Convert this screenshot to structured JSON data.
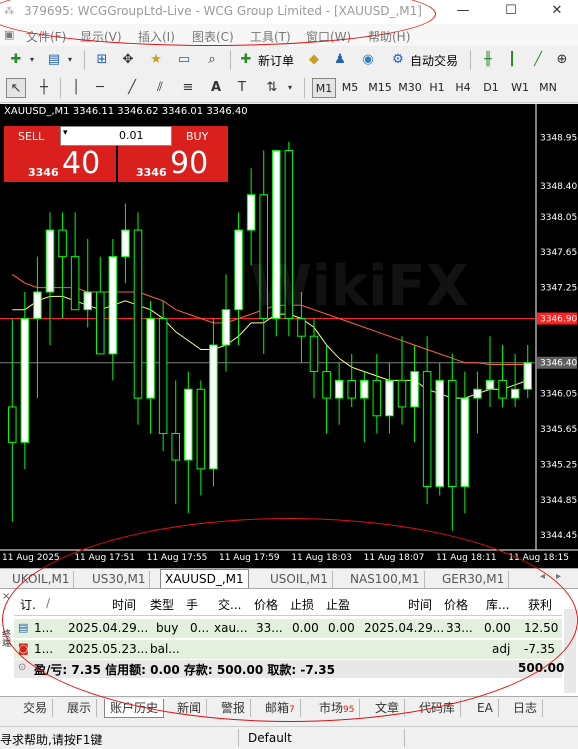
{
  "window": {
    "title": "379695: WCGGroupLtd-Live - WCG Group Limited - [XAUUSD_,M1]",
    "app_icon": "mt4-icon"
  },
  "menu": [
    "文件(F)",
    "显示(V)",
    "插入(I)",
    "图表(C)",
    "工具(T)",
    "窗口(W)",
    "帮助(H)"
  ],
  "toolbar1": {
    "new_order_label": "新订单",
    "auto_trade_label": "自动交易"
  },
  "timeframes": [
    "M1",
    "M5",
    "M15",
    "M30",
    "H1",
    "H4",
    "D1",
    "W1",
    "MN"
  ],
  "active_timeframe": "M1",
  "chart": {
    "title": "XAUUSD_,M1  3346.11 3346.62 3346.01 3346.40",
    "watermark": "WikiFX",
    "price_labels": [
      "3348.95",
      "3348.40",
      "3348.05",
      "3347.65",
      "3347.25",
      "3346.90",
      "3346.40",
      "3346.05",
      "3345.65",
      "3345.25",
      "3344.85",
      "3344.45"
    ],
    "bid_tag": "3346.40",
    "ask_tag": "3346.90",
    "time_labels": [
      "11 Aug 2025",
      "11 Aug 17:51",
      "11 Aug 17:55",
      "11 Aug 17:59",
      "11 Aug 18:03",
      "11 Aug 18:07",
      "11 Aug 18:11",
      "11 Aug 18:15"
    ],
    "colors": {
      "bull": "#ffffff",
      "bear": "#000000",
      "wick": "#00ff00",
      "ma_fast": "#ffff80",
      "ma_slow": "#ff6040",
      "ask_line": "#ff2020",
      "bid_line": "#808080"
    }
  },
  "chart_data": {
    "type": "candlestick",
    "title": "XAUUSD_,M1",
    "ylim": [
      3344.35,
      3349.1
    ],
    "candles": [
      {
        "o": 3345.9,
        "h": 3346.9,
        "l": 3344.6,
        "c": 3345.5
      },
      {
        "o": 3345.5,
        "h": 3347.2,
        "l": 3345.2,
        "c": 3346.9
      },
      {
        "o": 3346.9,
        "h": 3347.6,
        "l": 3346.0,
        "c": 3347.2
      },
      {
        "o": 3347.2,
        "h": 3348.1,
        "l": 3346.6,
        "c": 3347.9
      },
      {
        "o": 3347.9,
        "h": 3348.1,
        "l": 3346.9,
        "c": 3347.6
      },
      {
        "o": 3347.6,
        "h": 3348.1,
        "l": 3347.0,
        "c": 3347.0
      },
      {
        "o": 3347.0,
        "h": 3347.8,
        "l": 3346.8,
        "c": 3347.2
      },
      {
        "o": 3347.2,
        "h": 3347.6,
        "l": 3346.6,
        "c": 3346.5
      },
      {
        "o": 3346.5,
        "h": 3347.8,
        "l": 3346.2,
        "c": 3347.6
      },
      {
        "o": 3347.6,
        "h": 3348.2,
        "l": 3347.3,
        "c": 3347.9
      },
      {
        "o": 3347.9,
        "h": 3348.1,
        "l": 3345.7,
        "c": 3346.0
      },
      {
        "o": 3346.0,
        "h": 3347.1,
        "l": 3345.6,
        "c": 3346.9
      },
      {
        "o": 3346.9,
        "h": 3347.1,
        "l": 3345.4,
        "c": 3345.6
      },
      {
        "o": 3345.6,
        "h": 3346.2,
        "l": 3344.8,
        "c": 3345.3
      },
      {
        "o": 3345.3,
        "h": 3346.3,
        "l": 3344.7,
        "c": 3346.1
      },
      {
        "o": 3346.1,
        "h": 3346.2,
        "l": 3344.9,
        "c": 3345.2
      },
      {
        "o": 3345.2,
        "h": 3346.9,
        "l": 3345.0,
        "c": 3346.6
      },
      {
        "o": 3346.6,
        "h": 3347.4,
        "l": 3346.3,
        "c": 3347.0
      },
      {
        "o": 3347.0,
        "h": 3348.1,
        "l": 3346.6,
        "c": 3347.9
      },
      {
        "o": 3347.9,
        "h": 3348.6,
        "l": 3347.5,
        "c": 3348.3
      },
      {
        "o": 3348.3,
        "h": 3348.8,
        "l": 3346.5,
        "c": 3346.9
      },
      {
        "o": 3346.9,
        "h": 3348.8,
        "l": 3346.7,
        "c": 3348.8
      },
      {
        "o": 3348.8,
        "h": 3348.9,
        "l": 3346.7,
        "c": 3346.9
      },
      {
        "o": 3346.9,
        "h": 3347.2,
        "l": 3346.4,
        "c": 3346.7
      },
      {
        "o": 3346.7,
        "h": 3346.9,
        "l": 3346.0,
        "c": 3346.3
      },
      {
        "o": 3346.3,
        "h": 3346.6,
        "l": 3345.6,
        "c": 3346.0
      },
      {
        "o": 3346.0,
        "h": 3346.4,
        "l": 3345.7,
        "c": 3346.2
      },
      {
        "o": 3346.2,
        "h": 3346.5,
        "l": 3345.9,
        "c": 3346.0
      },
      {
        "o": 3346.0,
        "h": 3346.3,
        "l": 3345.5,
        "c": 3346.2
      },
      {
        "o": 3346.2,
        "h": 3346.5,
        "l": 3345.6,
        "c": 3345.8
      },
      {
        "o": 3345.8,
        "h": 3346.4,
        "l": 3345.6,
        "c": 3346.2
      },
      {
        "o": 3346.2,
        "h": 3346.7,
        "l": 3345.7,
        "c": 3345.9
      },
      {
        "o": 3345.9,
        "h": 3346.6,
        "l": 3345.5,
        "c": 3346.3
      },
      {
        "o": 3346.3,
        "h": 3346.7,
        "l": 3344.8,
        "c": 3345.0
      },
      {
        "o": 3345.0,
        "h": 3346.4,
        "l": 3344.9,
        "c": 3346.2
      },
      {
        "o": 3346.2,
        "h": 3346.5,
        "l": 3344.5,
        "c": 3345.0
      },
      {
        "o": 3345.0,
        "h": 3346.3,
        "l": 3344.7,
        "c": 3346.0
      },
      {
        "o": 3346.0,
        "h": 3346.3,
        "l": 3345.6,
        "c": 3346.1
      },
      {
        "o": 3346.1,
        "h": 3346.7,
        "l": 3345.9,
        "c": 3346.2
      },
      {
        "o": 3346.2,
        "h": 3346.6,
        "l": 3345.9,
        "c": 3346.0
      },
      {
        "o": 3346.0,
        "h": 3346.5,
        "l": 3345.9,
        "c": 3346.1
      },
      {
        "o": 3346.1,
        "h": 3346.6,
        "l": 3346.0,
        "c": 3346.4
      }
    ],
    "ma_fast": [
      3347.0,
      3347.0,
      3347.1,
      3347.15,
      3347.15,
      3347.1,
      3347.05,
      3347.0,
      3347.05,
      3347.1,
      3347.05,
      3347.0,
      3346.9,
      3346.75,
      3346.65,
      3346.55,
      3346.55,
      3346.6,
      3346.7,
      3346.85,
      3346.85,
      3346.95,
      3346.95,
      3346.9,
      3346.8,
      3346.6,
      3346.45,
      3346.35,
      3346.3,
      3346.25,
      3346.2,
      3346.2,
      3346.2,
      3346.1,
      3346.05,
      3346.0,
      3346.0,
      3346.05,
      3346.1,
      3346.1,
      3346.15,
      3346.2
    ],
    "ma_slow": [
      3347.4,
      3347.3,
      3347.25,
      3347.25,
      3347.25,
      3347.25,
      3347.2,
      3347.2,
      3347.2,
      3347.2,
      3347.2,
      3347.15,
      3347.1,
      3347.0,
      3346.95,
      3346.9,
      3346.85,
      3346.85,
      3346.9,
      3346.95,
      3347.0,
      3347.05,
      3347.05,
      3347.05,
      3347.0,
      3346.95,
      3346.9,
      3346.85,
      3346.8,
      3346.75,
      3346.7,
      3346.65,
      3346.6,
      3346.55,
      3346.5,
      3346.45,
      3346.4,
      3346.4,
      3346.38,
      3346.38,
      3346.38,
      3346.38
    ],
    "ask": 3346.9,
    "bid": 3346.4
  },
  "trade_panel": {
    "sell_label": "SELL",
    "buy_label": "BUY",
    "lot": "0.01",
    "sell_prefix": "3346",
    "sell_big": "40",
    "buy_prefix": "3346",
    "buy_big": "90"
  },
  "symbol_tabs": [
    "UKOIL,M1",
    "US30,M1",
    "XAUUSD_,M1",
    "USOIL,M1",
    "NAS100,M1",
    "GER30,M1"
  ],
  "active_symbol_tab": "XAUUSD_,M1",
  "terminal": {
    "headers": [
      "订.",
      "/",
      "时间",
      "类型",
      "手",
      "交...",
      "价格",
      "止损",
      "止盈",
      "时间",
      "价格",
      "库...",
      "获利"
    ],
    "rows": [
      [
        "1...",
        "2025.04.29...",
        "buy",
        "0...",
        "xau...",
        "33...",
        "0.00",
        "0.00",
        "2025.04.29...",
        "33...",
        "0.00",
        "12.50"
      ],
      [
        "1...",
        "2025.05.23...",
        "bal...",
        "",
        "",
        "",
        "",
        "",
        "",
        "",
        "adj",
        "-7.35"
      ]
    ],
    "summary": "盈/亏: 7.35  信用额: 0.00  存款: 500.00  取款: -7.35",
    "summary_total": "500.00",
    "side_label": "终端"
  },
  "bottom_tabs": [
    {
      "label": "交易"
    },
    {
      "label": "展示"
    },
    {
      "label": "账户历史"
    },
    {
      "label": "新闻"
    },
    {
      "label": "警报"
    },
    {
      "label": "邮箱",
      "badge": "7"
    },
    {
      "label": "市场",
      "badge": "95"
    },
    {
      "label": "文章"
    },
    {
      "label": "代码库"
    },
    {
      "label": "EA"
    },
    {
      "label": "日志"
    }
  ],
  "active_bottom_tab": "账户历史",
  "status": {
    "help": "寻求帮助,请按F1键",
    "profile": "Default"
  }
}
